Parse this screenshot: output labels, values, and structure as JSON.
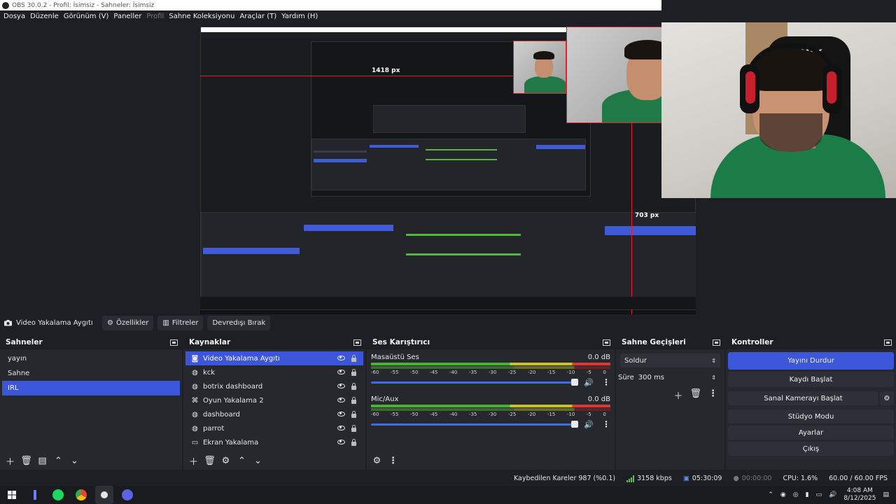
{
  "window": {
    "title": "OBS 30.0.2 - Profil: İsimsiz - Sahneler: İsimsiz"
  },
  "menu": [
    {
      "label": "Dosya",
      "enabled": true
    },
    {
      "label": "Düzenle",
      "enabled": true
    },
    {
      "label": "Görünüm (V)",
      "enabled": true
    },
    {
      "label": "Paneller",
      "enabled": true
    },
    {
      "label": "Profil",
      "enabled": false
    },
    {
      "label": "Sahne Koleksiyonu",
      "enabled": true
    },
    {
      "label": "Araçlar (T)",
      "enabled": true
    },
    {
      "label": "Yardım (H)",
      "enabled": true
    }
  ],
  "preview": {
    "width_label": "1418 px",
    "height_label": "703 px"
  },
  "webcam": {
    "chair_text": "AWK"
  },
  "source_toolbar": {
    "source_name": "Video Yakalama Aygıtı",
    "properties": "Özellikler",
    "filters": "Filtreler",
    "deactivate": "Devredışı Bırak"
  },
  "scenes": {
    "title": "Sahneler",
    "items": [
      "yayın",
      "Sahne",
      "IRL"
    ],
    "selected": "IRL"
  },
  "sources": {
    "title": "Kaynaklar",
    "items": [
      {
        "name": "Video Yakalama Aygıtı",
        "icon": "camera-icon"
      },
      {
        "name": "kck",
        "icon": "globe-icon"
      },
      {
        "name": "botrix dashboard",
        "icon": "globe-icon"
      },
      {
        "name": "Oyun Yakalama 2",
        "icon": "gamepad-icon"
      },
      {
        "name": "dashboard",
        "icon": "globe-icon"
      },
      {
        "name": "parrot",
        "icon": "globe-icon"
      },
      {
        "name": "Ekran Yakalama",
        "icon": "monitor-icon"
      }
    ],
    "selected": "Video Yakalama Aygıtı"
  },
  "mixer": {
    "title": "Ses Karıştırıcı",
    "channels": [
      {
        "name": "Masaüstü Ses",
        "db": "0.0 dB"
      },
      {
        "name": "Mic/Aux",
        "db": "0.0 dB"
      }
    ],
    "ticks": [
      "-60",
      "-55",
      "-50",
      "-45",
      "-40",
      "-35",
      "-30",
      "-25",
      "-20",
      "-15",
      "-10",
      "-5",
      "0"
    ]
  },
  "transitions": {
    "title": "Sahne Geçişleri",
    "selected": "Soldur",
    "duration_label": "Süre",
    "duration_value": "300 ms"
  },
  "controls": {
    "title": "Kontroller",
    "stop_stream": "Yayını Durdur",
    "start_recording": "Kaydı Başlat",
    "virtual_camera": "Sanal Kamerayı Başlat",
    "studio_mode": "Stüdyo Modu",
    "settings": "Ayarlar",
    "exit": "Çıkış"
  },
  "status": {
    "dropped_frames": "Kaybedilen Kareler 987 (%0.1)",
    "bitrate": "3158 kbps",
    "stream_time": "05:30:09",
    "record_time": "00:00:00",
    "cpu": "CPU: 1.6%",
    "fps": "60.00 / 60.00 FPS"
  },
  "taskbar": {
    "time": "4:08 AM",
    "date": "8/12/2025"
  },
  "colors": {
    "accent": "#3b56d8",
    "guide": "#e0202a",
    "panel": "#26282e",
    "background": "#1e1f24"
  }
}
